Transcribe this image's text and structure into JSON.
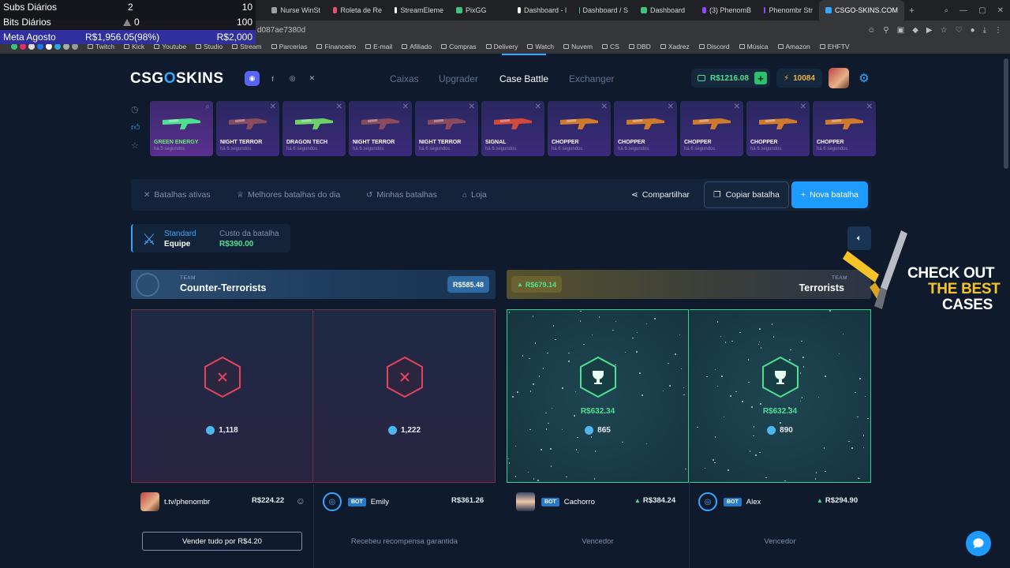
{
  "browser": {
    "tabs": [
      {
        "label": "Nurse WinSt",
        "color": "#9aa0a6"
      },
      {
        "label": "Roleta de Re",
        "color": "#e94e6a"
      },
      {
        "label": "StreamEleme",
        "color": "#ffffff"
      },
      {
        "label": "PixGG",
        "color": "#3cc47c"
      },
      {
        "label": "Dashboard - l",
        "color": "#ffffff"
      },
      {
        "label": "Dashboard / S",
        "color": "#3cc47c"
      },
      {
        "label": "Dashboard",
        "color": "#3cc47c"
      },
      {
        "label": "(3) PhenomB",
        "color": "#9146ff"
      },
      {
        "label": "Phenombr Str",
        "color": "#9146ff"
      },
      {
        "label": "CSGO-SKINS.COM",
        "color": "#35a7ff",
        "active": true
      }
    ],
    "new_tab": "+",
    "url": "d087ae7380d",
    "bookmarks": [
      "Twitch",
      "Kick",
      "Youtube",
      "Studio",
      "Stream",
      "Parcerias",
      "Financeiro",
      "E-mail",
      "Afiliado",
      "Compras",
      "Delivery",
      "Watch",
      "Nuvem",
      "CS",
      "DBD",
      "Xadrez",
      "Discord",
      "Música",
      "Amazon",
      "EHFTV"
    ]
  },
  "overlay": {
    "subs_label": "Subs Diários",
    "subs_value": "2",
    "subs_goal": "10",
    "bits_label": "Bits Diários",
    "bits_value": "0",
    "bits_goal": "100",
    "meta_label": "Meta Agosto",
    "meta_value": "R$1,956.05(98%)",
    "meta_goal": "R$2,000"
  },
  "header": {
    "logo_a": "CSG",
    "logo_o": "O",
    "logo_b": "SKINS",
    "nav": [
      {
        "label": "Caixas"
      },
      {
        "label": "Upgrader"
      },
      {
        "label": "Case Battle",
        "active": true
      },
      {
        "label": "Exchanger"
      }
    ],
    "balance": "R$1216.08",
    "points": "10084"
  },
  "drops": [
    {
      "name": "GREEN ENERGY",
      "time": "há 5 segundos",
      "style": "green",
      "gun": "#4fe08f"
    },
    {
      "name": "NIGHT TERROR",
      "time": "há 6 segundos",
      "style": "purple",
      "gun": "#8a4b5c"
    },
    {
      "name": "DRAGON TECH",
      "time": "há 6 segundos",
      "style": "purple",
      "gun": "#6bd16b"
    },
    {
      "name": "NIGHT TERROR",
      "time": "há 6 segundos",
      "style": "purple",
      "gun": "#8a4b5c"
    },
    {
      "name": "NIGHT TERROR",
      "time": "há 6 segundos",
      "style": "purple",
      "gun": "#8a4b5c"
    },
    {
      "name": "SIGNAL",
      "time": "há 6 segundos",
      "style": "purple",
      "gun": "#d24a3c"
    },
    {
      "name": "CHOPPER",
      "time": "há 6 segundos",
      "style": "purple",
      "gun": "#d07a2e"
    },
    {
      "name": "CHOPPER",
      "time": "há 6 segundos",
      "style": "purple",
      "gun": "#d07a2e"
    },
    {
      "name": "CHOPPER",
      "time": "há 6 segundos",
      "style": "purple",
      "gun": "#d07a2e"
    },
    {
      "name": "CHOPPER",
      "time": "há 6 segundos",
      "style": "purple",
      "gun": "#d07a2e"
    },
    {
      "name": "CHOPPER",
      "time": "há 6 segundos",
      "style": "purple",
      "gun": "#d07a2e"
    }
  ],
  "toolbar": {
    "active_battles": "Batalhas ativas",
    "best_battles": "Melhores batalhas do dia",
    "my_battles": "Minhas batalhas",
    "shop": "Loja",
    "share": "Compartilhar",
    "copy": "Copiar batalha",
    "new": "Nova batalha"
  },
  "battle": {
    "mode": "Standard",
    "team_mode": "Equipe",
    "cost_label": "Custo da batalha",
    "cost_value": "R$390.00"
  },
  "teams": {
    "label": "TEAM",
    "ct_name": "Counter-Terrorists",
    "ct_total": "R$585.48",
    "t_name": "Terrorists",
    "t_total": "R$679.14"
  },
  "arenas": [
    {
      "result": "lose",
      "tickets": "1,118",
      "amount": ""
    },
    {
      "result": "lose",
      "tickets": "1,222",
      "amount": ""
    },
    {
      "result": "win",
      "tickets": "865",
      "amount": "R$632.34"
    },
    {
      "result": "win",
      "tickets": "890",
      "amount": "R$632.34"
    }
  ],
  "players": [
    {
      "name": "t.tv/phenombr",
      "value": "R$224.22",
      "bot": false,
      "bot_label": "",
      "status": "Vender tudo por R$4.20"
    },
    {
      "name": "Emily",
      "value": "R$361.26",
      "bot": true,
      "bot_label": "BOT",
      "status": "Recebeu recompensa garantida"
    },
    {
      "name": "Cachorro",
      "value": "R$384.24",
      "bot": true,
      "bot_label": "BOT",
      "status": "Vencedor"
    },
    {
      "name": "Alex",
      "value": "R$294.90",
      "bot": true,
      "bot_label": "BOT",
      "status": "Vencedor"
    }
  ],
  "promo": {
    "line1": "CHECK OUT",
    "line2": "THE BEST",
    "line3": "CASES"
  },
  "colors": {
    "accent": "#35a7ff",
    "win": "#4fe08f",
    "lose": "#e2445c"
  }
}
